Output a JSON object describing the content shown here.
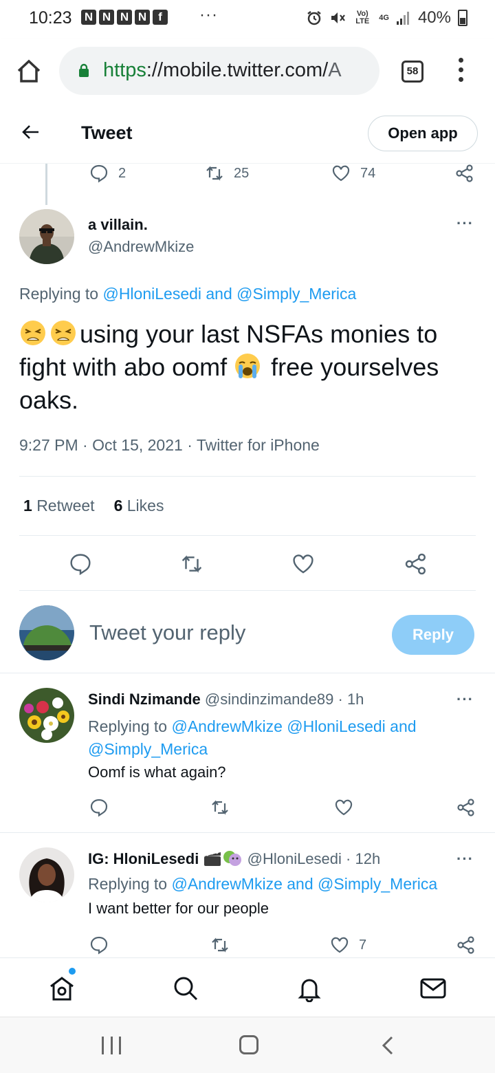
{
  "status_bar": {
    "time": "10:23",
    "notification_letters": [
      "N",
      "N",
      "N",
      "N",
      "f"
    ],
    "more": "···",
    "volte": "Vo) LTE",
    "network": "4G",
    "battery": "40%"
  },
  "browser": {
    "url_scheme": "https",
    "url_rest": "://mobile.twitter.com/",
    "url_tail": "A",
    "tab_count": "58"
  },
  "header": {
    "title": "Tweet",
    "open_app": "Open app"
  },
  "parent_tweet": {
    "replies": "2",
    "retweets": "25",
    "likes": "74"
  },
  "main_tweet": {
    "name": "a villain.",
    "handle": "@AndrewMkize",
    "replying_prefix": "Replying to ",
    "replying_to": "@HloniLesedi and @Simply_Merica",
    "text_part1": "using your last NSFAs monies to fight with abo oomf ",
    "text_part2": " free yourselves oaks.",
    "emoji_1": "weary-face-emoji",
    "emoji_2": "crying-face-emoji",
    "time": "9:27 PM",
    "date": "Oct 15, 2021",
    "source": "Twitter for iPhone",
    "separator": " · ",
    "retweet_count": "1",
    "retweet_label": "Retweet",
    "like_count": "6",
    "like_label": "Likes"
  },
  "reply_box": {
    "placeholder": "Tweet your reply",
    "button": "Reply"
  },
  "replies": [
    {
      "name": "Sindi Nzimande",
      "handle": "@sindinzimande89",
      "time": "· 1h",
      "replying_prefix": "Replying to ",
      "replying_to_line1": "@AndrewMkize @HloniLesedi and",
      "replying_to_line2": "@Simply_Merica",
      "text": "Oomf is what again?",
      "likes": ""
    },
    {
      "name": "IG: HloniLesedi",
      "handle": "@HloniLesedi",
      "time": "· 12h",
      "replying_prefix": "Replying to ",
      "replying_to": "@AndrewMkize and @Simply_Merica",
      "text": "I want better for our people",
      "likes": "7"
    }
  ],
  "colors": {
    "twitter_blue": "#1d9bf0",
    "reply_button_disabled": "#8ecdf8",
    "secondary_text": "#536471"
  }
}
